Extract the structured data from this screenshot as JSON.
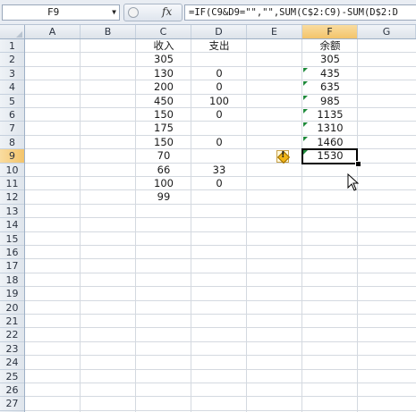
{
  "formula_bar": {
    "name_box": "F9",
    "fx_label": "fx",
    "formula": "=IF(C9&D9=\"\",\"\",SUM(C$2:C9)-SUM(D$2:D"
  },
  "columns": [
    "A",
    "B",
    "C",
    "D",
    "E",
    "F",
    "G"
  ],
  "active_column": "F",
  "rows": [
    "1",
    "2",
    "3",
    "4",
    "5",
    "6",
    "7",
    "8",
    "9",
    "10",
    "11",
    "12",
    "13",
    "14",
    "15",
    "16",
    "17",
    "18",
    "19",
    "20",
    "21",
    "22",
    "23",
    "24",
    "25",
    "26",
    "27"
  ],
  "active_row": "9",
  "sheet": {
    "C": [
      "收入",
      "305",
      "130",
      "200",
      "450",
      "150",
      "175",
      "150",
      "70",
      "66",
      "100",
      "99"
    ],
    "D": [
      "支出",
      "",
      "0",
      "0",
      "100",
      "0",
      "",
      "0",
      "",
      "33",
      "0",
      ""
    ],
    "F": [
      "余额",
      "305",
      "435",
      "635",
      "985",
      "1135",
      "1310",
      "1460",
      "1530",
      "",
      "",
      ""
    ]
  },
  "selected_cell": "F9"
}
